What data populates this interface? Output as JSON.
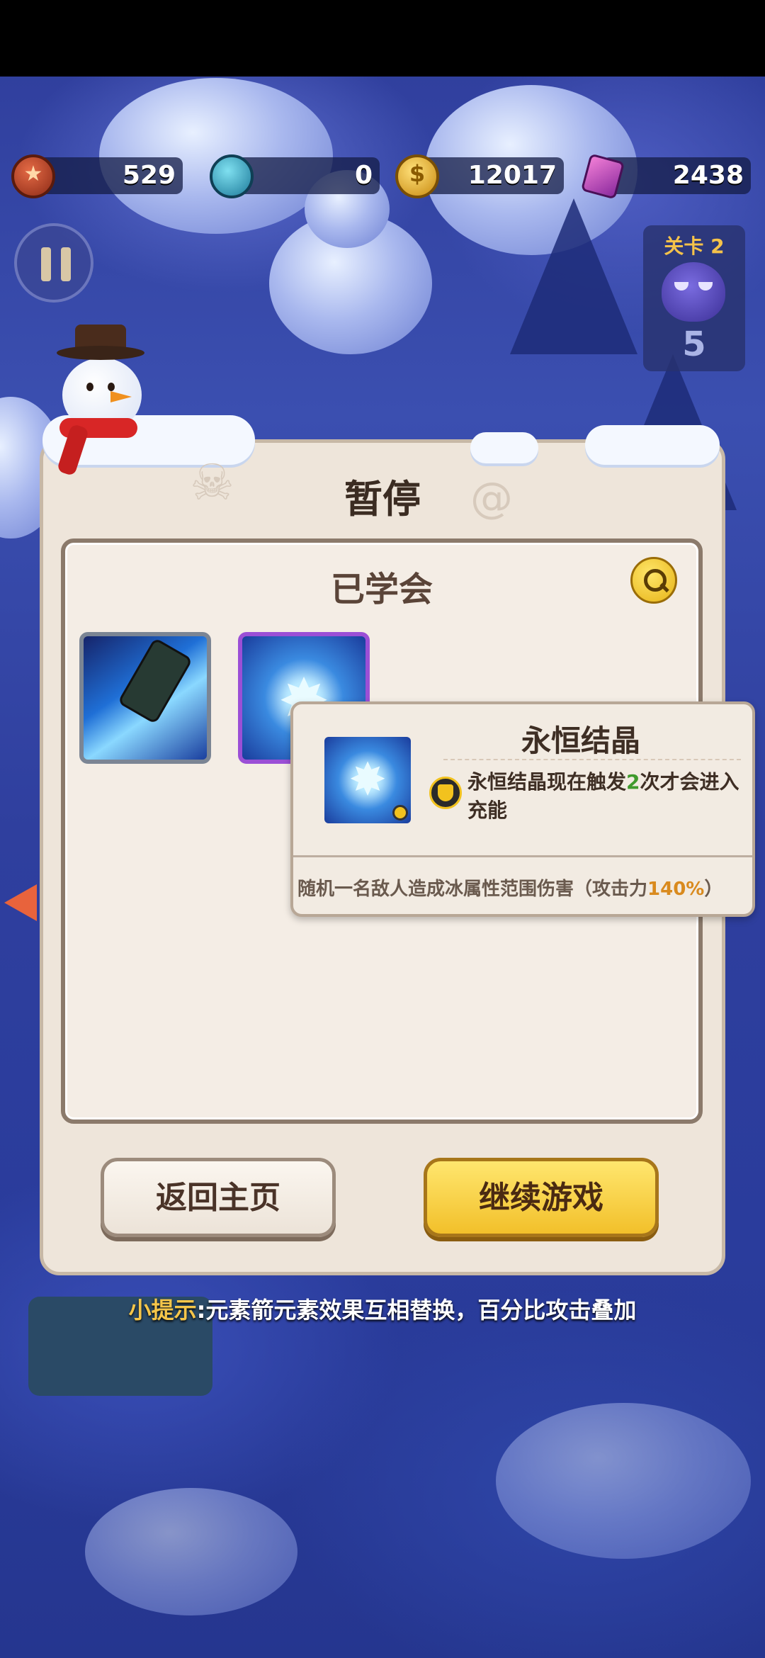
{
  "resources": {
    "medals": "529",
    "timers": "0",
    "coins": "12017",
    "gems": "2438"
  },
  "level": {
    "label": "关卡 2",
    "wave": "5"
  },
  "pause_dialog": {
    "title": "暂停",
    "learned_title": "已学会",
    "skills": [
      {
        "icon": "ice-arrow-quiver-icon"
      },
      {
        "icon": "ice-crystal-star-icon"
      }
    ],
    "tooltip": {
      "name": "永恒结晶",
      "desc_prefix": "永恒结晶现在触发",
      "desc_count": "2",
      "desc_suffix": "次才会进入充能",
      "foot_prefix": "随机一名敌人造成冰属性范围伤害（攻击力",
      "foot_value": "140%",
      "foot_suffix": "）"
    },
    "home_button": "返回主页",
    "continue_button": "继续游戏"
  },
  "hint": {
    "label": "小提示",
    "text": ":元素箭元素效果互相替换，百分比攻击叠加"
  },
  "colors": {
    "highlight_green": "#3f9a2c",
    "highlight_orange": "#d98a1e",
    "hint_label": "#f5c64a",
    "continue_button": "#f2c02a"
  }
}
